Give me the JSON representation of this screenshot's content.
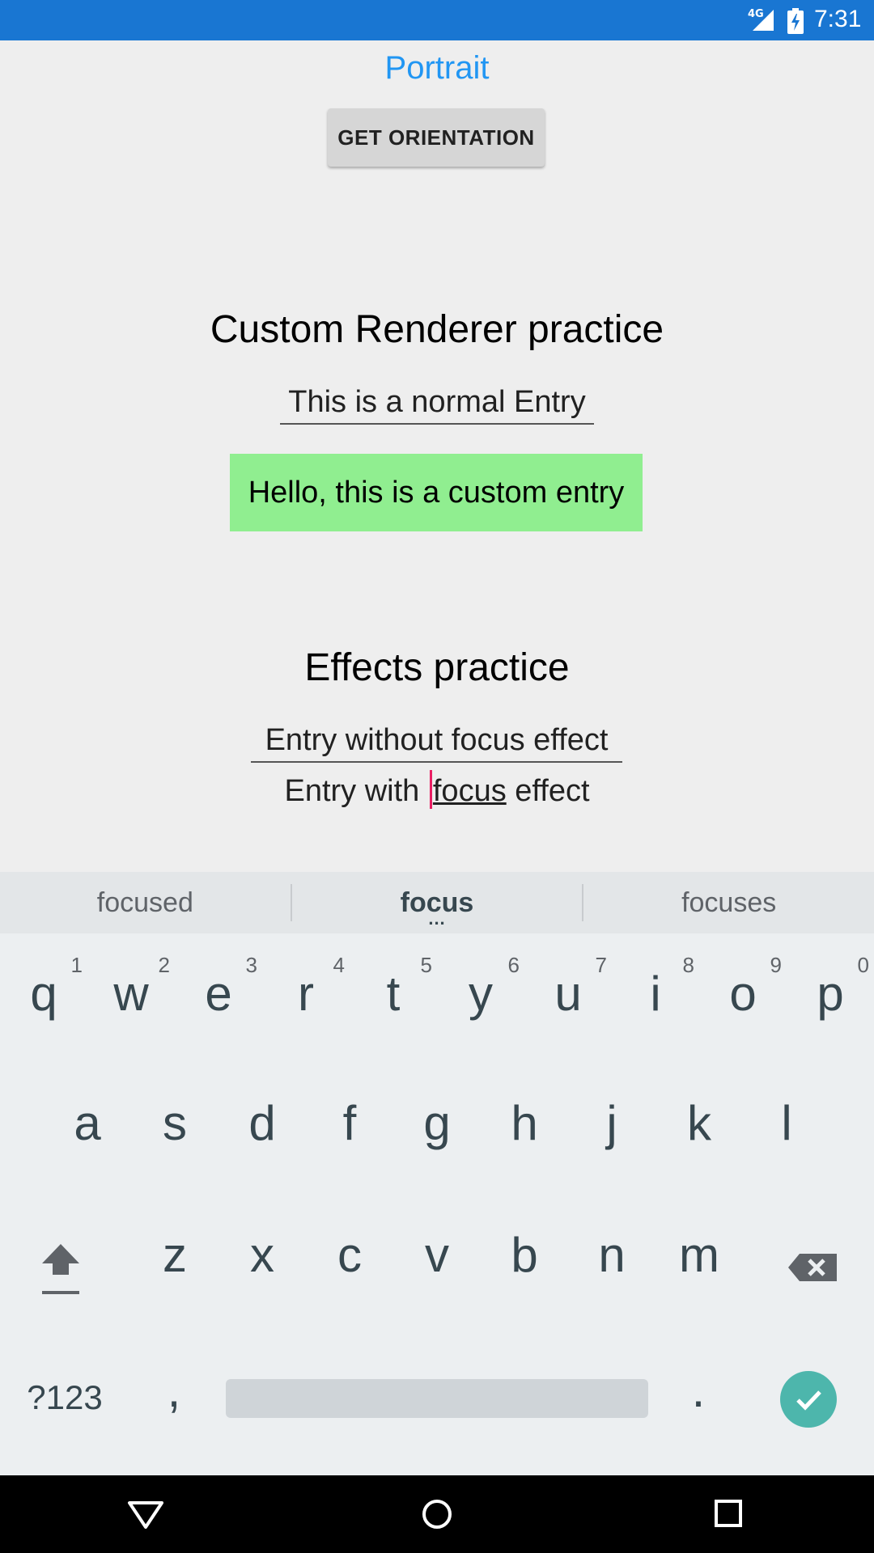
{
  "status_bar": {
    "network": "4G",
    "time": "7:31",
    "color": "#1976d2"
  },
  "app": {
    "orientation_label": "Portrait",
    "orientation_button": "GET ORIENTATION",
    "custom_renderer_title": "Custom Renderer practice",
    "normal_entry_text": "This is a normal Entry",
    "custom_entry_text": "Hello, this is a custom entry",
    "custom_entry_color": "#90ee90",
    "effects_title": "Effects practice",
    "entry_without_focus_text": "Entry without focus effect",
    "entry_with_focus": {
      "before": "Entry with ",
      "word": "focus",
      "after": " effect"
    }
  },
  "keyboard": {
    "suggestions": [
      "focused",
      "focus",
      "focuses"
    ],
    "row1": [
      {
        "ch": "q",
        "hint": "1"
      },
      {
        "ch": "w",
        "hint": "2"
      },
      {
        "ch": "e",
        "hint": "3"
      },
      {
        "ch": "r",
        "hint": "4"
      },
      {
        "ch": "t",
        "hint": "5"
      },
      {
        "ch": "y",
        "hint": "6"
      },
      {
        "ch": "u",
        "hint": "7"
      },
      {
        "ch": "i",
        "hint": "8"
      },
      {
        "ch": "o",
        "hint": "9"
      },
      {
        "ch": "p",
        "hint": "0"
      }
    ],
    "row2": [
      "a",
      "s",
      "d",
      "f",
      "g",
      "h",
      "j",
      "k",
      "l"
    ],
    "row3": [
      "z",
      "x",
      "c",
      "v",
      "b",
      "n",
      "m"
    ],
    "symbols_label": "?123",
    "comma": ",",
    "period": ".",
    "enter_color": "#4db6ac"
  },
  "nav_bar": {
    "icons": [
      "back-icon",
      "home-icon",
      "recents-icon"
    ]
  }
}
